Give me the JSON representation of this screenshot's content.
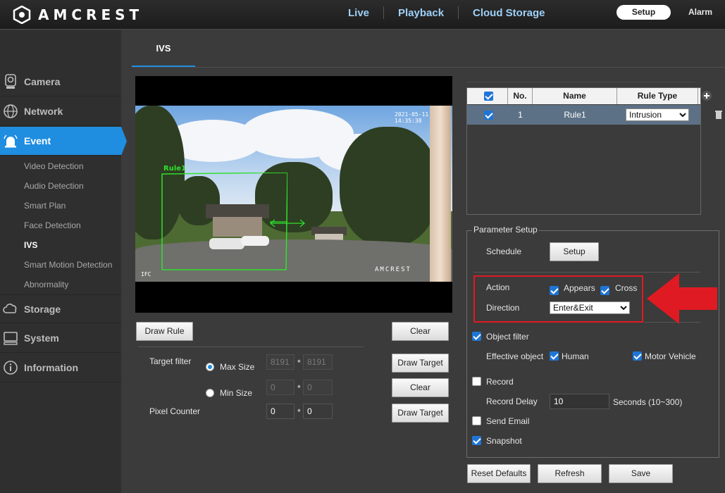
{
  "header": {
    "brand": "AMCREST",
    "nav": [
      "Live",
      "Playback",
      "Cloud Storage"
    ],
    "setup_label": "Setup",
    "alarm_label": "Alarm"
  },
  "sidebar": {
    "main": [
      "Camera",
      "Network",
      "Event",
      "Storage",
      "System",
      "Information"
    ],
    "event_sub": [
      "Video Detection",
      "Audio Detection",
      "Smart Plan",
      "Face Detection",
      "IVS",
      "Smart Motion Detection",
      "Abnormality"
    ],
    "active_main": "Event",
    "active_sub": "IVS"
  },
  "tab": {
    "label": "IVS"
  },
  "video": {
    "timestamp": "2021-05-11 14:35:38",
    "channel_osd": "IFC",
    "rule_label": "Rule1",
    "watermark": "AMCREST"
  },
  "left_controls": {
    "draw_rule": "Draw Rule",
    "clear": "Clear",
    "target_filter_label": "Target filter",
    "max_size_label": "Max Size",
    "min_size_label": "Min Size",
    "max_w": "8191",
    "max_h": "8191",
    "min_w": "0",
    "min_h": "0",
    "times": "*",
    "draw_target": "Draw Target",
    "pixel_counter_label": "Pixel Counter",
    "pc_w": "0",
    "pc_h": "0",
    "size_selected": "Max Size"
  },
  "rule_table": {
    "headers": [
      "No.",
      "Name",
      "Rule Type"
    ],
    "rows": [
      {
        "checked": true,
        "no": "1",
        "name": "Rule1",
        "rule_type": "Intrusion"
      }
    ]
  },
  "params": {
    "legend": "Parameter Setup",
    "schedule_label": "Schedule",
    "setup_button": "Setup",
    "action_label": "Action",
    "appears_label": "Appears",
    "cross_label": "Cross",
    "appears_checked": true,
    "cross_checked": true,
    "direction_label": "Direction",
    "direction_value": "Enter&Exit",
    "object_filter_label": "Object filter",
    "object_filter_checked": true,
    "effective_object_label": "Effective object",
    "human_label": "Human",
    "human_checked": true,
    "motor_vehicle_label": "Motor Vehicle",
    "motor_vehicle_checked": true,
    "record_label": "Record",
    "record_checked": false,
    "record_delay_label": "Record Delay",
    "record_delay_value": "10",
    "record_delay_unit": "Seconds (10~300)",
    "send_email_label": "Send Email",
    "send_email_checked": false,
    "snapshot_label": "Snapshot",
    "snapshot_checked": true
  },
  "footer_buttons": {
    "reset": "Reset Defaults",
    "refresh": "Refresh",
    "save": "Save"
  },
  "colors": {
    "accent": "#1f8de0",
    "highlight": "#e01a22",
    "row_selected": "#5d7186"
  }
}
